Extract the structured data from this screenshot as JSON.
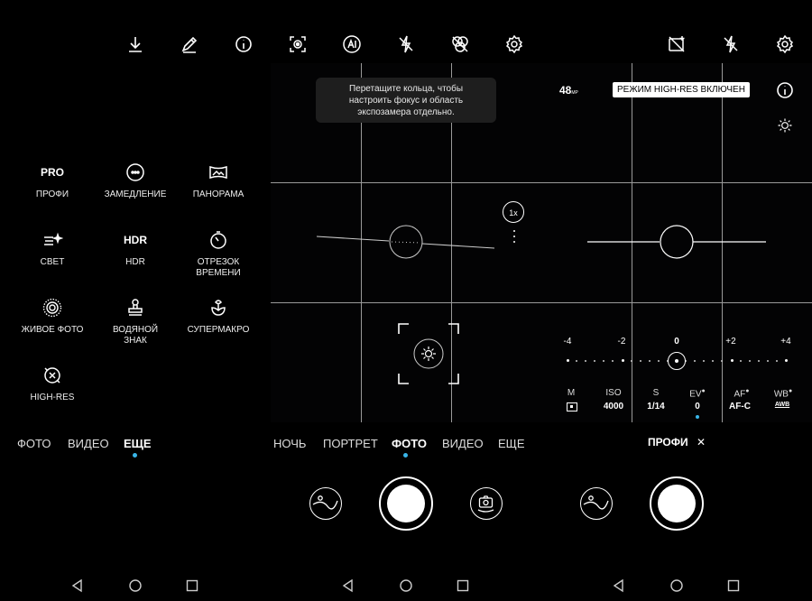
{
  "panel1": {
    "modes": [
      {
        "glyph_text": "PRO",
        "label": "ПРОФИ"
      },
      {
        "icon": "slow-motion-icon",
        "label": "ЗАМЕДЛЕНИЕ"
      },
      {
        "icon": "panorama-icon",
        "label": "ПАНОРАМА"
      },
      {
        "icon": "light-painting-icon",
        "label": "СВЕТ"
      },
      {
        "glyph_text": "HDR",
        "label": "HDR"
      },
      {
        "icon": "timelapse-icon",
        "label": "ОТРЕЗОК\nВРЕМЕНИ"
      },
      {
        "icon": "live-photo-icon",
        "label": "ЖИВОЕ ФОТО"
      },
      {
        "icon": "watermark-icon",
        "label": "ВОДЯНОЙ\nЗНАК"
      },
      {
        "icon": "super-macro-icon",
        "label": "СУПЕРМАКРО"
      },
      {
        "icon": "high-res-icon",
        "label": "HIGH-RES"
      }
    ],
    "tabs": [
      "ФОТО",
      "ВИДЕО",
      "ЕЩЕ"
    ],
    "active_tab": "ЕЩЕ"
  },
  "panel2": {
    "toast": "Перетащите кольца, чтобы\nнастроить фокус и область\nэкспозамера отдельно.",
    "zoom": "1x",
    "tabs": [
      "НОЧЬ",
      "ПОРТРЕТ",
      "ФОТО",
      "ВИДЕО",
      "ЕЩЕ"
    ],
    "active_tab": "ФОТО"
  },
  "panel3": {
    "megapixels": "48",
    "megapixels_unit": "MP",
    "badge": "РЕЖИМ HIGH-RES ВКЛЮЧЕН",
    "ev_scale": [
      "-4",
      "-2",
      "0",
      "+2",
      "+4"
    ],
    "params": [
      {
        "name": "M",
        "value": "",
        "value_icon": "metering-icon"
      },
      {
        "name": "ISO",
        "value": "4000"
      },
      {
        "name": "S",
        "value": "1/14"
      },
      {
        "name": "EV",
        "value": "0",
        "auto": true
      },
      {
        "name": "AF",
        "value": "AF-C",
        "auto": true
      },
      {
        "name": "WB",
        "value": "AWB",
        "auto": true
      }
    ],
    "mode_title": "ПРОФИ",
    "close_glyph": "✕"
  },
  "colors": {
    "accent": "#39b5e8",
    "background": "#000000"
  }
}
